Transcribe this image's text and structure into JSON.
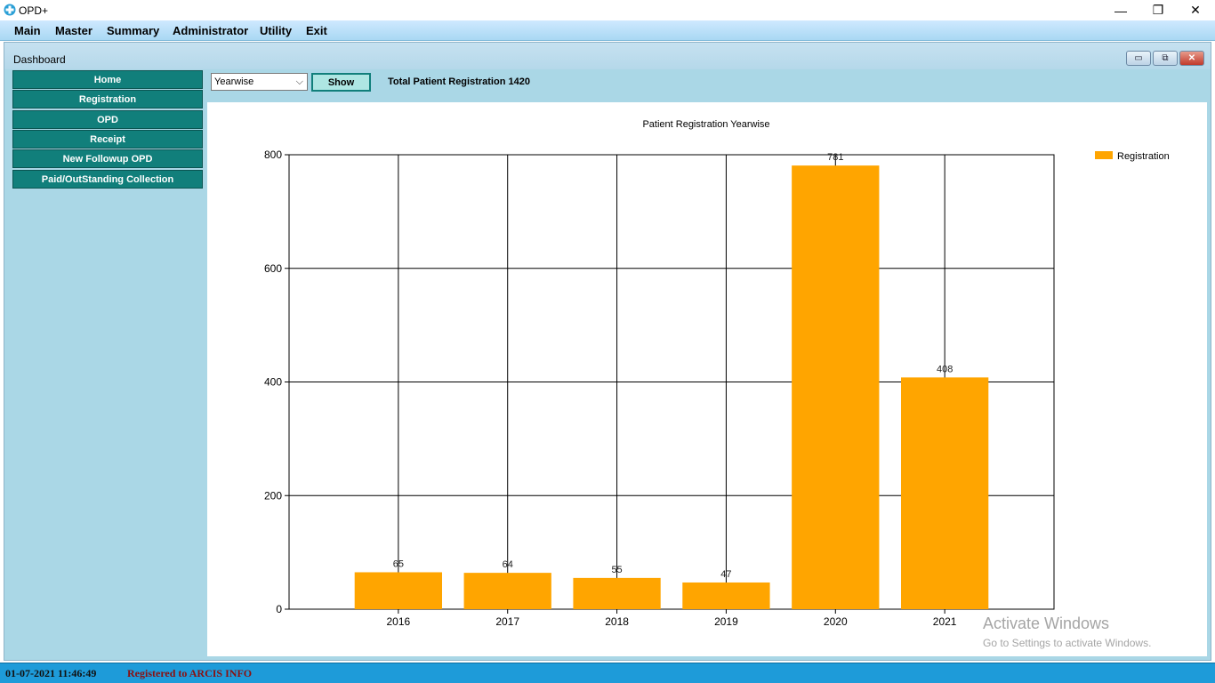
{
  "window": {
    "title": "OPD+",
    "min": "—",
    "max": "❐",
    "close": "✕"
  },
  "menu": [
    "Main",
    "Master",
    "Summary",
    "Administrator",
    "Utility",
    "Exit"
  ],
  "dashboard": {
    "title": "Dashboard",
    "controls": {
      "min": "▭",
      "restore": "⧉",
      "close": "✕"
    }
  },
  "sidebar": {
    "items": [
      "Home",
      "Registration",
      "OPD",
      "Receipt",
      "New Followup OPD",
      "Paid/OutStanding Collection"
    ]
  },
  "toolbar": {
    "select_value": "Yearwise",
    "show_label": "Show",
    "total_text": "Total Patient Registration 1420"
  },
  "colors": {
    "bar": "#ffa500",
    "nav": "#117f7b",
    "status_bar": "#1e9bd9"
  },
  "chart_data": {
    "type": "bar",
    "title": "Patient Registration Yearwise",
    "categories": [
      "2016",
      "2017",
      "2018",
      "2019",
      "2020",
      "2021"
    ],
    "series": [
      {
        "name": "Registration",
        "values": [
          65,
          64,
          55,
          47,
          781,
          408
        ]
      }
    ],
    "ylim": [
      0,
      800
    ],
    "yticks": [
      "0",
      "200",
      "400",
      "600",
      "800"
    ],
    "grid": true,
    "legend": "top-right"
  },
  "status": {
    "datetime": "01-07-2021 11:46:49",
    "registered": "Registered to ARCIS INFO"
  },
  "watermark": {
    "line1": "Activate Windows",
    "line2": "Go to Settings to activate Windows."
  }
}
